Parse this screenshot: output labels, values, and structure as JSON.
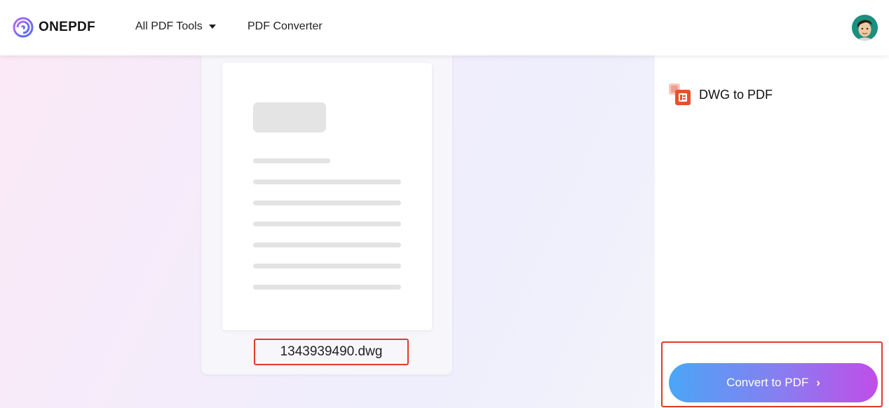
{
  "header": {
    "logo_text": "ONEPDF",
    "nav": [
      {
        "label": "All PDF Tools",
        "has_dropdown": true
      },
      {
        "label": "PDF Converter",
        "has_dropdown": false
      }
    ]
  },
  "file": {
    "name": "1343939490.dwg"
  },
  "side_panel": {
    "tool_label": "DWG to PDF",
    "tool_icon": "dwg-file-icon",
    "convert_label": "Convert to PDF",
    "convert_icon": "chevron-right-icon"
  },
  "colors": {
    "accent_gradient_start": "#4aa6f6",
    "accent_gradient_end": "#c14de8",
    "highlight_border": "#e33a2b",
    "logo_purple": "#7a4cf0"
  }
}
